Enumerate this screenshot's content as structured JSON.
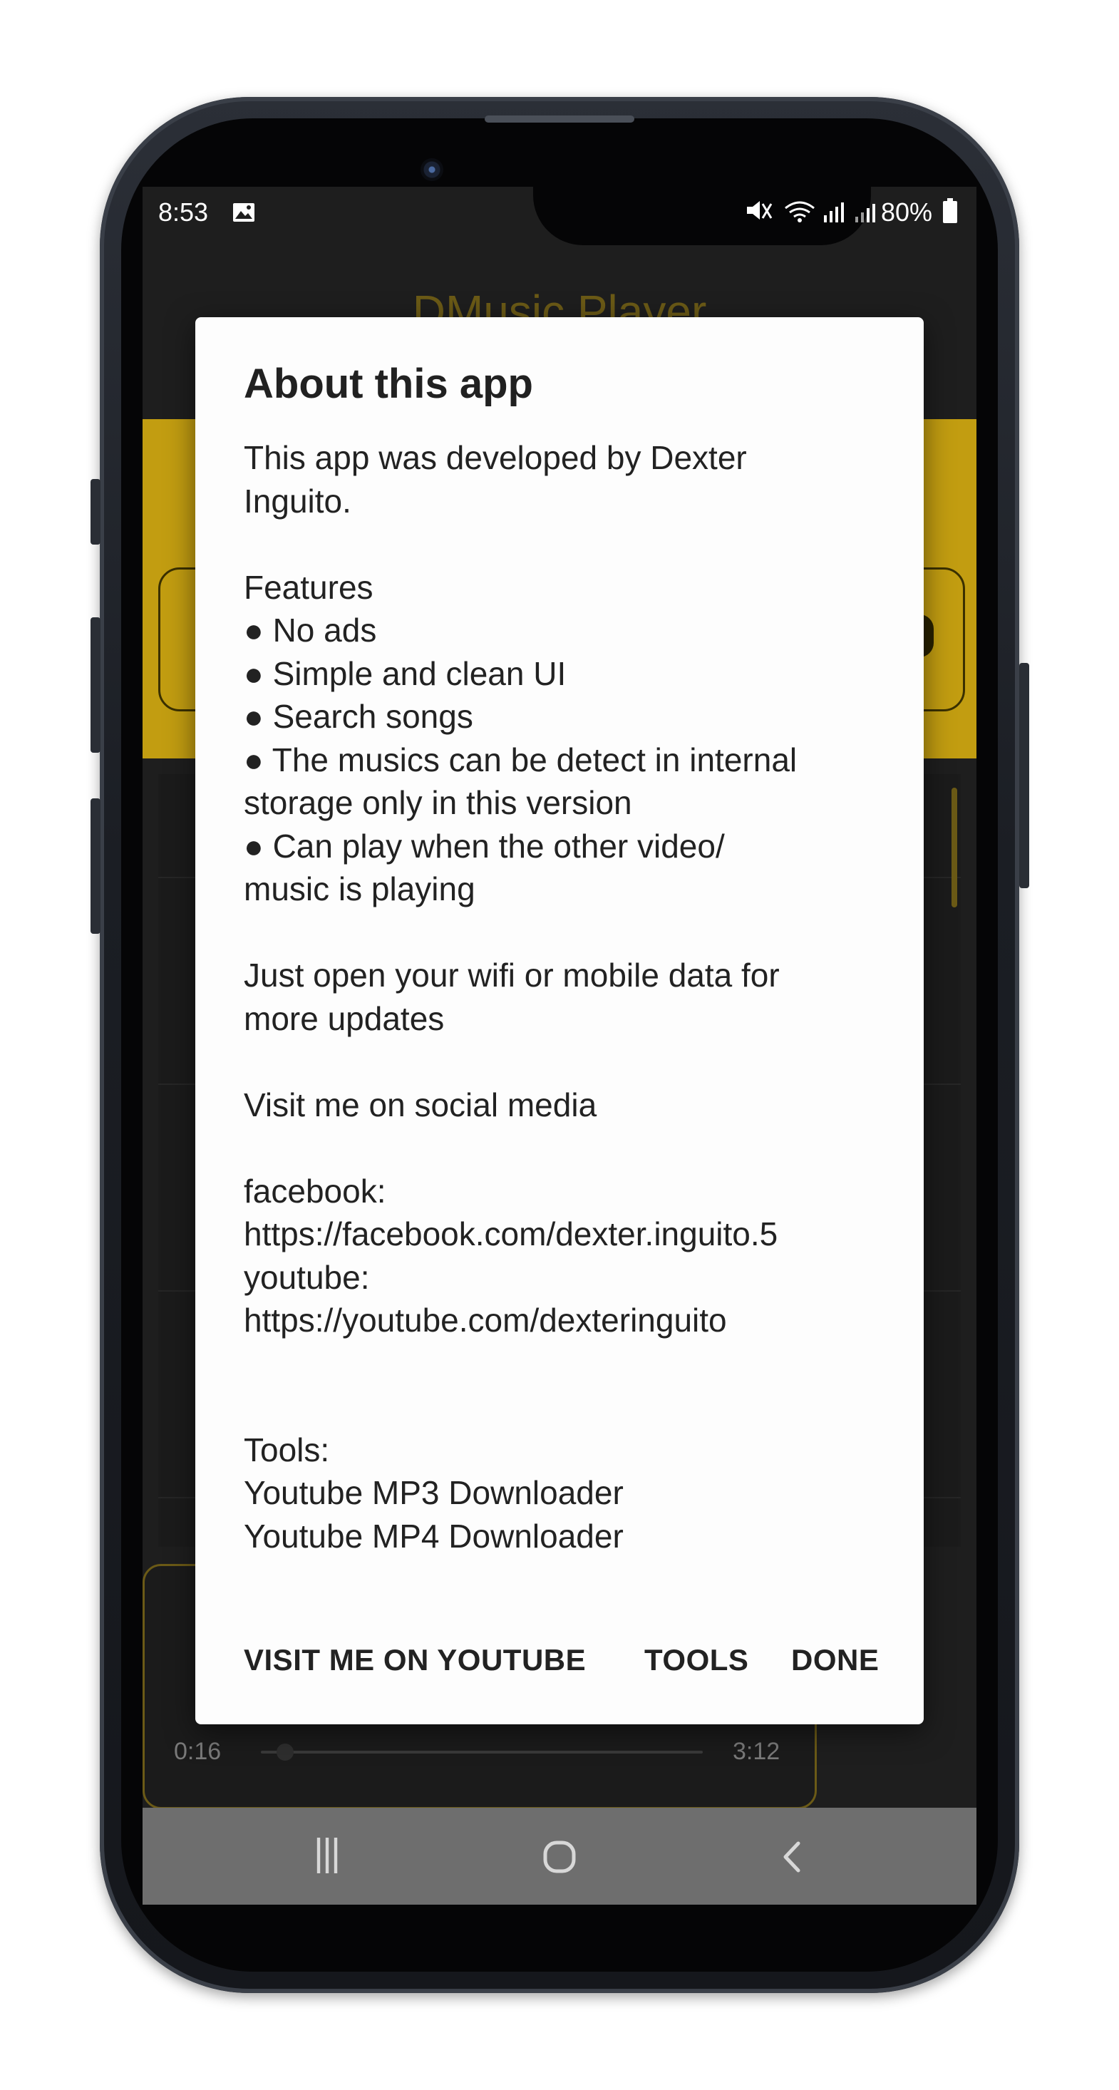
{
  "status_bar": {
    "time": "8:53",
    "indicators": "80%",
    "icons": [
      "image-icon",
      "mute-icon",
      "wifi-icon",
      "signal-icon",
      "signal-icon",
      "battery-icon"
    ]
  },
  "app": {
    "title": "DMusic Player",
    "player": {
      "elapsed": "0:16",
      "duration": "3:12"
    },
    "accent_color": "#c29d11"
  },
  "dialog": {
    "title": "About this app",
    "lines": [
      "This app was developed by Dexter",
      "Inguito.",
      "",
      "Features",
      "● No ads",
      "● Simple and clean UI",
      "● Search songs",
      "● The musics can be detect in internal",
      "storage only in this version",
      "● Can play when the other video/",
      "music is playing",
      "",
      "Just open your wifi or mobile data for",
      "more updates",
      "",
      "Visit me on social media",
      "",
      "facebook:",
      "https://facebook.com/dexter.inguito.5",
      "youtube:",
      "https://youtube.com/dexteringuito",
      "",
      "",
      "Tools:",
      "Youtube MP3 Downloader",
      "Youtube MP4 Downloader"
    ],
    "buttons": {
      "youtube": "VISIT ME ON YOUTUBE",
      "tools": "TOOLS",
      "done": "DONE"
    }
  },
  "navigation": {
    "recents": "|||",
    "home": "○",
    "back": "<"
  }
}
